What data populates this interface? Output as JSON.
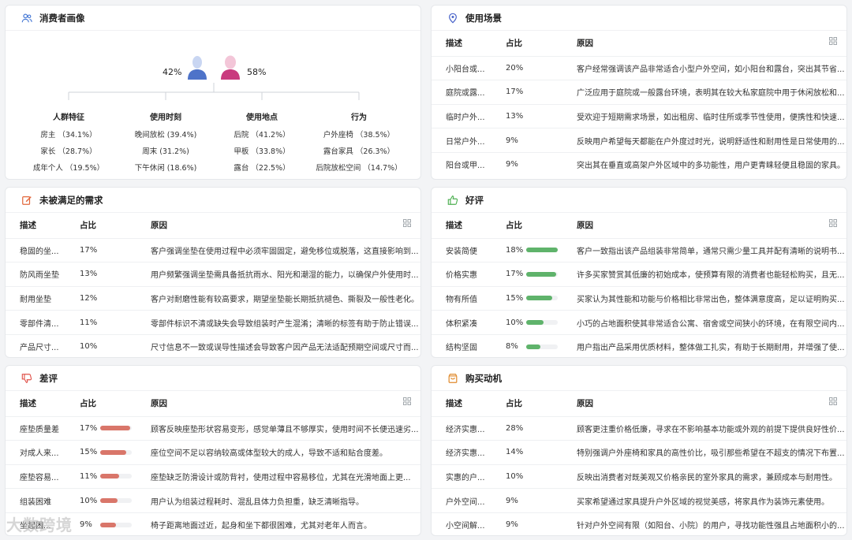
{
  "persona": {
    "title": "消费者画像",
    "male_pct": "42%",
    "female_pct": "58%",
    "groups": [
      {
        "title": "人群特征",
        "items": [
          "房主 （34.1%）",
          "家长 （28.7%）",
          "成年个人 （19.5%）"
        ]
      },
      {
        "title": "使用时刻",
        "items": [
          "晚间放松 (39.4%)",
          "周末 (31.2%)",
          "下午休闲 (18.6%)"
        ]
      },
      {
        "title": "使用地点",
        "items": [
          "后院 （41.2%）",
          "甲板 （33.8%）",
          "露台 （22.5%）"
        ]
      },
      {
        "title": "行为",
        "items": [
          "户外座椅 （38.5%）",
          "露台家具 （26.3%）",
          "后院放松空间 （14.7%）"
        ]
      }
    ]
  },
  "scenarios": {
    "title": "使用场景",
    "headers": {
      "desc": "描述",
      "ratio": "占比",
      "reason": "原因"
    },
    "rows": [
      {
        "desc": "小阳台或...",
        "ratio": "20%",
        "reason": "客户经常强调该产品非常适合小型户外空间，如小阳台和露台，突出其节省..."
      },
      {
        "desc": "庭院或露...",
        "ratio": "17%",
        "reason": "广泛应用于庭院或一般露台环境，表明其在较大私家庭院中用于休闲放松和..."
      },
      {
        "desc": "临时户外...",
        "ratio": "13%",
        "reason": "受欢迎于短期需求场景，如出租房、临时住所或季节性使用，便携性和快速..."
      },
      {
        "desc": "日常户外...",
        "ratio": "9%",
        "reason": "反映用户希望每天都能在户外度过时光，说明舒适性和耐用性是日常使用的..."
      },
      {
        "desc": "阳台或甲...",
        "ratio": "9%",
        "reason": "突出其在垂直或高架户外区域中的多功能性，用户更青睐轻便且稳固的家具。"
      }
    ]
  },
  "unmet": {
    "title": "未被满足的需求",
    "headers": {
      "desc": "描述",
      "ratio": "占比",
      "reason": "原因"
    },
    "rows": [
      {
        "desc": "稳固的坐...",
        "ratio": "17%",
        "reason": "客户强调坐垫在使用过程中必须牢固固定，避免移位或脱落，这直接影响到..."
      },
      {
        "desc": "防风雨坐垫",
        "ratio": "13%",
        "reason": "用户频繁强调坐垫需具备抵抗雨水、阳光和潮湿的能力，以确保户外使用时..."
      },
      {
        "desc": "耐用坐垫",
        "ratio": "12%",
        "reason": "客户对耐磨性能有较高要求，期望坐垫能长期抵抗褪色、撕裂及一般性老化。"
      },
      {
        "desc": "零部件清...",
        "ratio": "11%",
        "reason": "零部件标识不清或缺失会导致组装时产生混淆；清晰的标签有助于防止错误..."
      },
      {
        "desc": "产品尺寸...",
        "ratio": "10%",
        "reason": "尺寸信息不一致或误导性描述会导致客户因产品无法适配预期空间或尺寸而..."
      }
    ]
  },
  "positive": {
    "title": "好评",
    "color": "#5fb36b",
    "headers": {
      "desc": "描述",
      "ratio": "占比",
      "reason": "原因"
    },
    "rows": [
      {
        "desc": "安装简便",
        "ratio": "18%",
        "value": 18,
        "reason": "客户一致指出该产品组装非常简单，通常只需少量工具并配有清晰的说明书..."
      },
      {
        "desc": "价格实惠",
        "ratio": "17%",
        "value": 17,
        "reason": "许多买家赞赏其低廉的初始成本，使预算有限的消费者也能轻松购买，且无..."
      },
      {
        "desc": "物有所值",
        "ratio": "15%",
        "value": 15,
        "reason": "买家认为其性能和功能与价格相比非常出色，整体满意度高，足以证明购买..."
      },
      {
        "desc": "体积紧凑",
        "ratio": "10%",
        "value": 10,
        "reason": "小巧的占地面积使其非常适合公寓、宿舍或空间狭小的环境，在有限空间内..."
      },
      {
        "desc": "结构坚固",
        "ratio": "8%",
        "value": 8,
        "reason": "用户指出产品采用优质材料，整体做工扎实，有助于长期耐用，并增强了使..."
      }
    ]
  },
  "negative": {
    "title": "差评",
    "color": "#d9766a",
    "headers": {
      "desc": "描述",
      "ratio": "占比",
      "reason": "原因"
    },
    "rows": [
      {
        "desc": "座垫质量差",
        "ratio": "17%",
        "value": 17,
        "reason": "顾客反映座垫形状容易变形，感觉单薄且不够厚实，使用时间不长便迅速劣..."
      },
      {
        "desc": "对成人来...",
        "ratio": "15%",
        "value": 15,
        "reason": "座位空间不足以容纳较高或体型较大的成人，导致不适和贴合度差。"
      },
      {
        "desc": "座垫容易...",
        "ratio": "11%",
        "value": 11,
        "reason": "座垫缺乏防滑设计或防背衬，使用过程中容易移位，尤其在光滑地面上更..."
      },
      {
        "desc": "组装困难",
        "ratio": "10%",
        "value": 10,
        "reason": "用户认为组装过程耗时、混乱且体力负担重，缺乏清晰指导。"
      },
      {
        "desc": "坐起困...",
        "ratio": "9%",
        "value": 9,
        "reason": "椅子距离地面过近，起身和坐下都很困难，尤其对老年人而言。"
      }
    ]
  },
  "motivation": {
    "title": "购买动机",
    "headers": {
      "desc": "描述",
      "ratio": "占比",
      "reason": "原因"
    },
    "rows": [
      {
        "desc": "经济实惠...",
        "ratio": "28%",
        "reason": "顾客更注重价格低廉，寻求在不影响基本功能或外观的前提下提供良好性价..."
      },
      {
        "desc": "经济实惠...",
        "ratio": "14%",
        "reason": "特别强调户外座椅和家具的高性价比，吸引那些希望在不超支的情况下布置..."
      },
      {
        "desc": "实惠的户...",
        "ratio": "10%",
        "reason": "反映出消费者对既美观又价格亲民的室外家具的需求，兼顾成本与耐用性。"
      },
      {
        "desc": "户外空间...",
        "ratio": "9%",
        "reason": "买家希望通过家具提升户外区域的视觉美感，将家具作为装饰元素使用。"
      },
      {
        "desc": "小空间解...",
        "ratio": "9%",
        "reason": "针对户外空间有限（如阳台、小院）的用户，寻找功能性强且占地面积小的..."
      }
    ]
  },
  "watermark": "大数跨境"
}
